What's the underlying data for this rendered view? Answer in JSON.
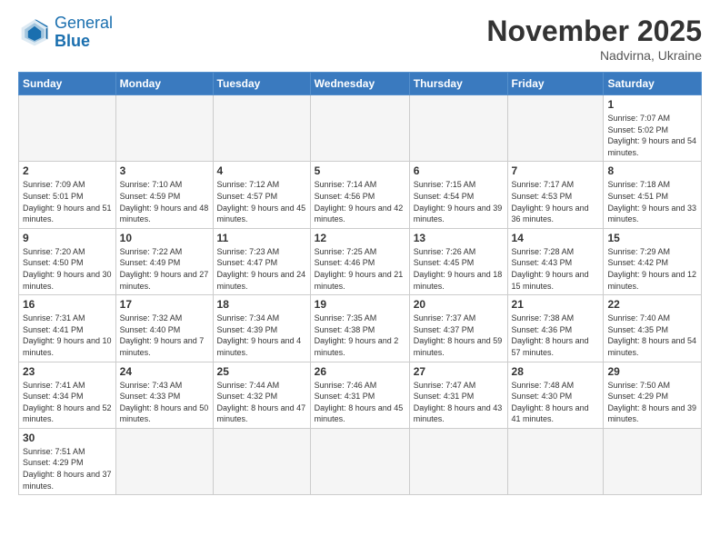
{
  "logo": {
    "line1": "General",
    "line2": "Blue"
  },
  "title": "November 2025",
  "subtitle": "Nadvirna, Ukraine",
  "weekdays": [
    "Sunday",
    "Monday",
    "Tuesday",
    "Wednesday",
    "Thursday",
    "Friday",
    "Saturday"
  ],
  "weeks": [
    [
      {
        "day": "",
        "info": ""
      },
      {
        "day": "",
        "info": ""
      },
      {
        "day": "",
        "info": ""
      },
      {
        "day": "",
        "info": ""
      },
      {
        "day": "",
        "info": ""
      },
      {
        "day": "",
        "info": ""
      },
      {
        "day": "1",
        "info": "Sunrise: 7:07 AM\nSunset: 5:02 PM\nDaylight: 9 hours\nand 54 minutes."
      }
    ],
    [
      {
        "day": "2",
        "info": "Sunrise: 7:09 AM\nSunset: 5:01 PM\nDaylight: 9 hours\nand 51 minutes."
      },
      {
        "day": "3",
        "info": "Sunrise: 7:10 AM\nSunset: 4:59 PM\nDaylight: 9 hours\nand 48 minutes."
      },
      {
        "day": "4",
        "info": "Sunrise: 7:12 AM\nSunset: 4:57 PM\nDaylight: 9 hours\nand 45 minutes."
      },
      {
        "day": "5",
        "info": "Sunrise: 7:14 AM\nSunset: 4:56 PM\nDaylight: 9 hours\nand 42 minutes."
      },
      {
        "day": "6",
        "info": "Sunrise: 7:15 AM\nSunset: 4:54 PM\nDaylight: 9 hours\nand 39 minutes."
      },
      {
        "day": "7",
        "info": "Sunrise: 7:17 AM\nSunset: 4:53 PM\nDaylight: 9 hours\nand 36 minutes."
      },
      {
        "day": "8",
        "info": "Sunrise: 7:18 AM\nSunset: 4:51 PM\nDaylight: 9 hours\nand 33 minutes."
      }
    ],
    [
      {
        "day": "9",
        "info": "Sunrise: 7:20 AM\nSunset: 4:50 PM\nDaylight: 9 hours\nand 30 minutes."
      },
      {
        "day": "10",
        "info": "Sunrise: 7:22 AM\nSunset: 4:49 PM\nDaylight: 9 hours\nand 27 minutes."
      },
      {
        "day": "11",
        "info": "Sunrise: 7:23 AM\nSunset: 4:47 PM\nDaylight: 9 hours\nand 24 minutes."
      },
      {
        "day": "12",
        "info": "Sunrise: 7:25 AM\nSunset: 4:46 PM\nDaylight: 9 hours\nand 21 minutes."
      },
      {
        "day": "13",
        "info": "Sunrise: 7:26 AM\nSunset: 4:45 PM\nDaylight: 9 hours\nand 18 minutes."
      },
      {
        "day": "14",
        "info": "Sunrise: 7:28 AM\nSunset: 4:43 PM\nDaylight: 9 hours\nand 15 minutes."
      },
      {
        "day": "15",
        "info": "Sunrise: 7:29 AM\nSunset: 4:42 PM\nDaylight: 9 hours\nand 12 minutes."
      }
    ],
    [
      {
        "day": "16",
        "info": "Sunrise: 7:31 AM\nSunset: 4:41 PM\nDaylight: 9 hours\nand 10 minutes."
      },
      {
        "day": "17",
        "info": "Sunrise: 7:32 AM\nSunset: 4:40 PM\nDaylight: 9 hours\nand 7 minutes."
      },
      {
        "day": "18",
        "info": "Sunrise: 7:34 AM\nSunset: 4:39 PM\nDaylight: 9 hours\nand 4 minutes."
      },
      {
        "day": "19",
        "info": "Sunrise: 7:35 AM\nSunset: 4:38 PM\nDaylight: 9 hours\nand 2 minutes."
      },
      {
        "day": "20",
        "info": "Sunrise: 7:37 AM\nSunset: 4:37 PM\nDaylight: 8 hours\nand 59 minutes."
      },
      {
        "day": "21",
        "info": "Sunrise: 7:38 AM\nSunset: 4:36 PM\nDaylight: 8 hours\nand 57 minutes."
      },
      {
        "day": "22",
        "info": "Sunrise: 7:40 AM\nSunset: 4:35 PM\nDaylight: 8 hours\nand 54 minutes."
      }
    ],
    [
      {
        "day": "23",
        "info": "Sunrise: 7:41 AM\nSunset: 4:34 PM\nDaylight: 8 hours\nand 52 minutes."
      },
      {
        "day": "24",
        "info": "Sunrise: 7:43 AM\nSunset: 4:33 PM\nDaylight: 8 hours\nand 50 minutes."
      },
      {
        "day": "25",
        "info": "Sunrise: 7:44 AM\nSunset: 4:32 PM\nDaylight: 8 hours\nand 47 minutes."
      },
      {
        "day": "26",
        "info": "Sunrise: 7:46 AM\nSunset: 4:31 PM\nDaylight: 8 hours\nand 45 minutes."
      },
      {
        "day": "27",
        "info": "Sunrise: 7:47 AM\nSunset: 4:31 PM\nDaylight: 8 hours\nand 43 minutes."
      },
      {
        "day": "28",
        "info": "Sunrise: 7:48 AM\nSunset: 4:30 PM\nDaylight: 8 hours\nand 41 minutes."
      },
      {
        "day": "29",
        "info": "Sunrise: 7:50 AM\nSunset: 4:29 PM\nDaylight: 8 hours\nand 39 minutes."
      }
    ],
    [
      {
        "day": "30",
        "info": "Sunrise: 7:51 AM\nSunset: 4:29 PM\nDaylight: 8 hours\nand 37 minutes."
      },
      {
        "day": "",
        "info": ""
      },
      {
        "day": "",
        "info": ""
      },
      {
        "day": "",
        "info": ""
      },
      {
        "day": "",
        "info": ""
      },
      {
        "day": "",
        "info": ""
      },
      {
        "day": "",
        "info": ""
      }
    ]
  ]
}
